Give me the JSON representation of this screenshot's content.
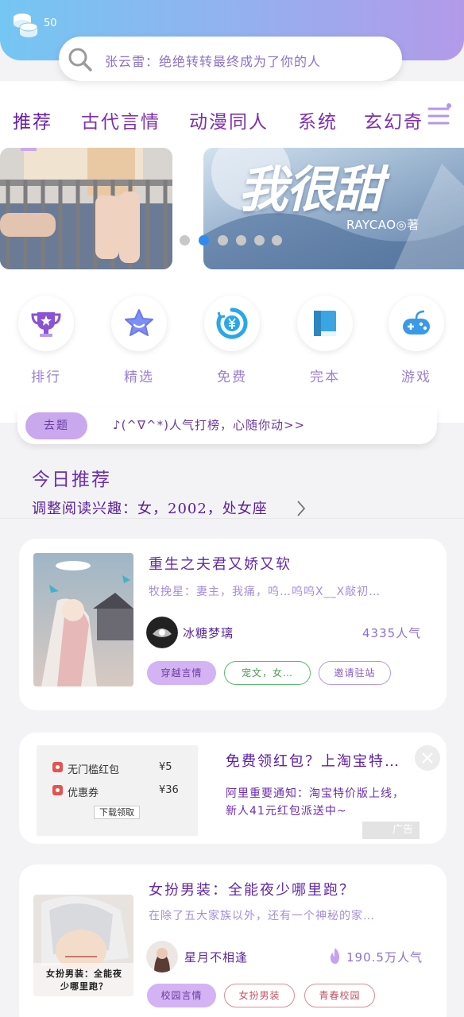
{
  "header": {
    "coin_count": "50",
    "search_placeholder": "张云雷：绝绝转转最终成为了你的人"
  },
  "tabs": [
    {
      "label": "推荐"
    },
    {
      "label": "古代言情"
    },
    {
      "label": "动漫同人"
    },
    {
      "label": "系统"
    },
    {
      "label": "玄幻奇"
    }
  ],
  "banner": {
    "right_title": "我很甜",
    "right_author": "RAYCAO◎著",
    "active_index": 1,
    "dot_count": 6
  },
  "categories": [
    {
      "label": "排行",
      "icon": "trophy-icon"
    },
    {
      "label": "精选",
      "icon": "star-icon"
    },
    {
      "label": "免费",
      "icon": "yen-icon"
    },
    {
      "label": "完本",
      "icon": "book-icon"
    },
    {
      "label": "游戏",
      "icon": "gamepad-icon"
    }
  ],
  "topic": {
    "tag": "去题",
    "text": "♪(^∇^*)人气打榜，心随你动>>"
  },
  "today": {
    "title": "今日推荐",
    "subtitle": "调整阅读兴趣：女，2002，处女座"
  },
  "books": [
    {
      "title": "重生之夫君又娇又软",
      "desc": "牧挽星：妻主，我痛，呜…呜呜X__X敲初…",
      "author": "冰糖梦璃",
      "popularity": "4335人气",
      "tags": [
        "穿越言情",
        "宠文，女…",
        "邀请驻站"
      ]
    },
    {
      "title": "女扮男装：全能夜少哪里跑？",
      "desc": "在除了五大家族以外，还有一个神秘的家…",
      "author": "星月不相逢",
      "popularity": "190.5万人气",
      "cover_text": "女扮男装：全能夜少哪里跑？",
      "tags": [
        "校园言情",
        "女扮男装",
        "青春校园"
      ]
    }
  ],
  "ad": {
    "rows": [
      {
        "label": "无门槛红包",
        "value": "¥5"
      },
      {
        "label": "优惠券",
        "value": "¥36"
      }
    ],
    "button": "下载领取",
    "title": "免费领红包？上淘宝特…",
    "desc": "阿里重要通知：淘宝特价版上线，新人41元红包派送中~",
    "badge": "广告"
  },
  "colors": {
    "accent_purple": "#7d2fb0",
    "header_gradient_start": "#74c6f3",
    "header_gradient_end": "#b39ae9",
    "dot_active": "#2e8cf0"
  }
}
